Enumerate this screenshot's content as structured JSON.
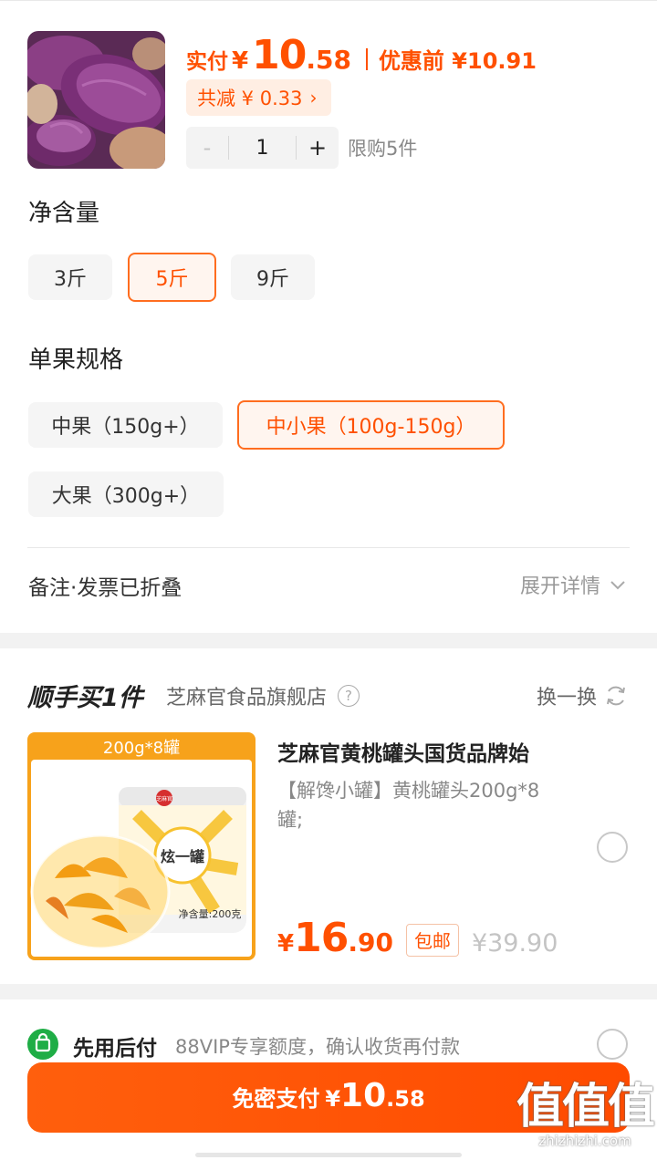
{
  "order": {
    "price_label": "实付",
    "currency": "¥",
    "price_int": "10",
    "price_dec": ".58",
    "price_before": "优惠前 ¥10.91",
    "discount": "共减 ¥ 0.33",
    "quantity": "1",
    "minus": "-",
    "plus": "+",
    "limit": "限购5件"
  },
  "spec_weight": {
    "title": "净含量",
    "options": [
      "3斤",
      "5斤",
      "9斤"
    ],
    "selected": "5斤"
  },
  "spec_size": {
    "title": "单果规格",
    "options": [
      "中果（150g+）",
      "中小果（100g-150g）",
      "大果（300g+）"
    ],
    "selected": "中小果（100g-150g）"
  },
  "note": {
    "label": "备注·发票已折叠",
    "expand": "展开详情"
  },
  "addon": {
    "title": "顺手买1件",
    "shop": "芝麻官食品旗舰店",
    "swap": "换一换",
    "product": {
      "badge": "200g*8罐",
      "brand_label": "芝麻官",
      "can_text": "炫一罐",
      "can_net": "净含量:200克",
      "name": "芝麻官黄桃罐头国货品牌始",
      "desc": "【解馋小罐】黄桃罐头200g*8罐;",
      "currency": "¥",
      "price_int": "16",
      "price_dec": ".90",
      "tag": "包邮",
      "orig_price": "¥39.90"
    }
  },
  "payment": {
    "title": "先用后付",
    "desc": "88VIP专享额度，确认收货再付款"
  },
  "paybar": {
    "label": "免密支付",
    "currency": "¥",
    "price_int": "10",
    "price_dec": ".58"
  },
  "watermark": {
    "main": "值值值",
    "sub": "zhizhizhi.com"
  },
  "colors": {
    "accent": "#ff5000",
    "selected_border": "#ff6d1f",
    "pay_green": "#1fad46"
  }
}
